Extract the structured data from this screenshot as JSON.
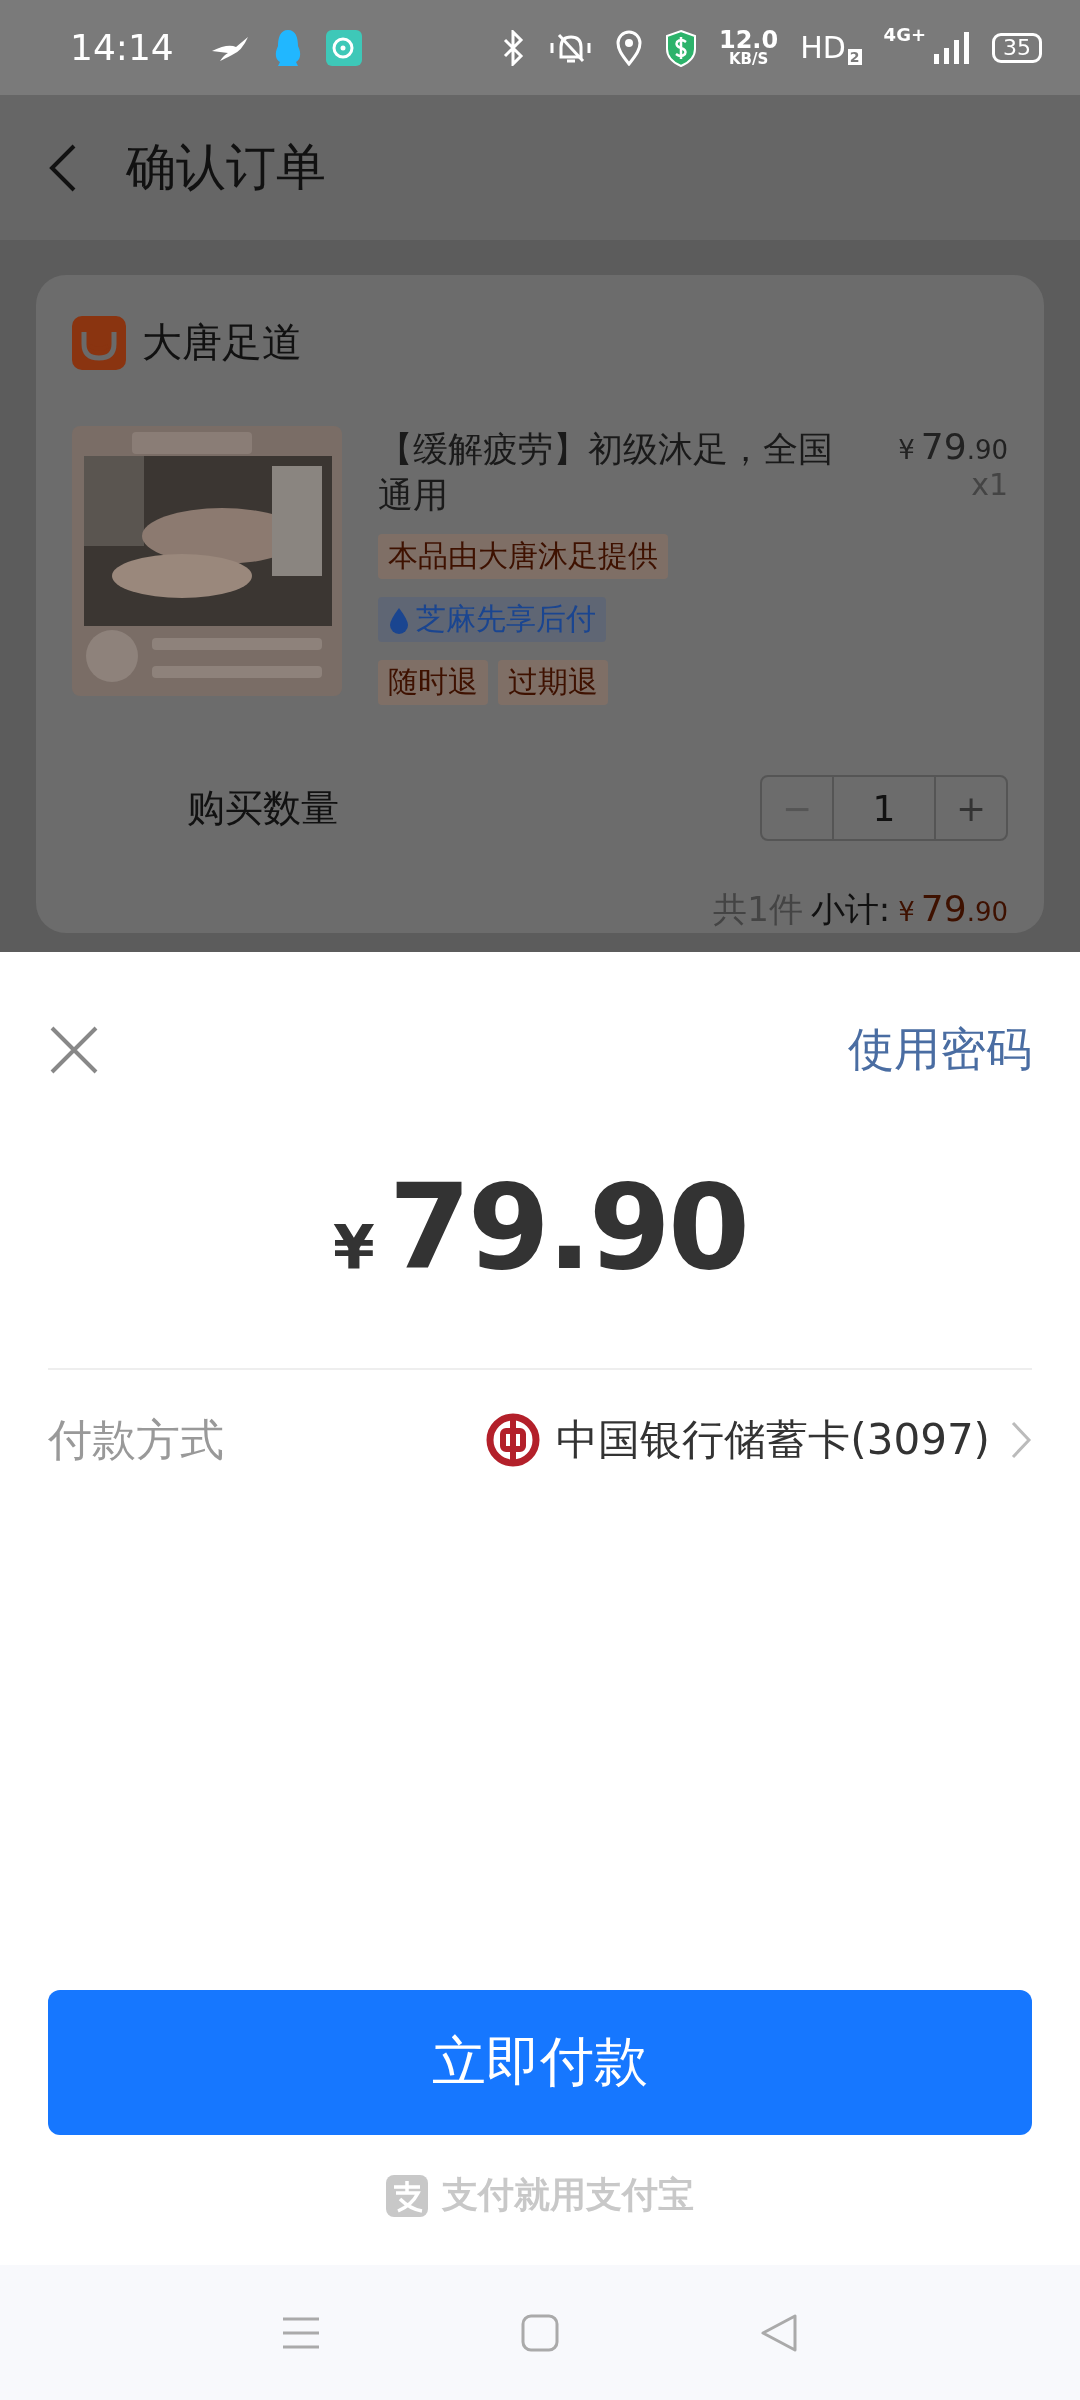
{
  "status_bar": {
    "time": "14:14",
    "net_speed": "12.0",
    "net_unit": "KB/S",
    "hd": "HD",
    "hd_sub": "2",
    "network": "4G+",
    "battery": "35"
  },
  "nav": {
    "title": "确认订单"
  },
  "order": {
    "shop": "大唐足道",
    "product": {
      "kind": "picture",
      "title": "【缓解疲劳】初级沐足，全国通用",
      "price_symbol": "¥",
      "price_int": "79",
      "price_dec": ".90",
      "qty": "x1",
      "tags": [
        {
          "kind": "provider",
          "label": "本品由大唐沐足提供"
        },
        {
          "kind": "credit",
          "label": "芝麻先享后付"
        },
        {
          "kind": "refund",
          "label": "随时退"
        },
        {
          "kind": "refund",
          "label": "过期退"
        }
      ]
    },
    "quantity": {
      "label": "购买数量",
      "minus": "−",
      "value": "1",
      "plus": "+",
      "minus_disabled": true
    },
    "summary": {
      "count": "共1件",
      "label": "小计:",
      "symbol": "¥",
      "int": "79",
      "dec": ".90"
    }
  },
  "payment": {
    "use_password": "使用密码",
    "amount_symbol": "¥",
    "amount": "79.90",
    "method_label": "付款方式",
    "method": "中国银行储蓄卡(3097)",
    "pay_button": "立即付款",
    "brand": "支付就用支付宝"
  }
}
